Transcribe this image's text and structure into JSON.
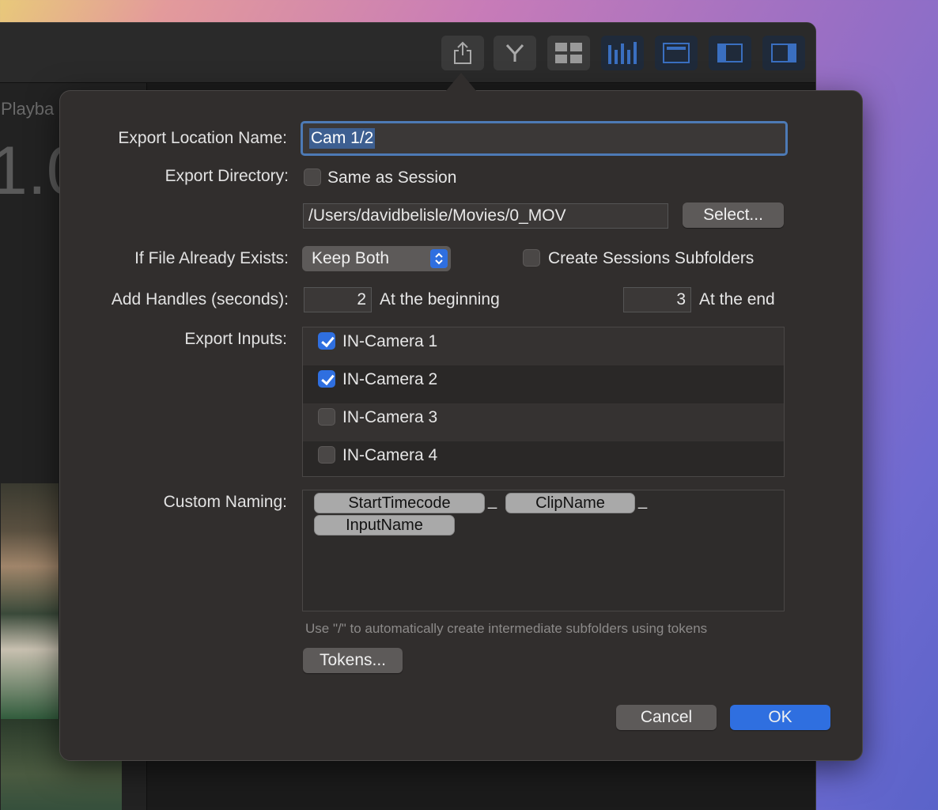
{
  "app": {
    "playback_label": "Playba",
    "speed_readout": "1.0"
  },
  "toolbar": {
    "buttons": [
      {
        "name": "share-icon"
      },
      {
        "name": "merge-icon"
      },
      {
        "name": "grid-icon"
      },
      {
        "name": "levels-icon"
      },
      {
        "name": "viewer-icon"
      },
      {
        "name": "left-sidebar-icon"
      },
      {
        "name": "right-sidebar-icon"
      }
    ]
  },
  "dialog": {
    "export_location_name_label": "Export Location Name:",
    "export_location_name_value": "Cam 1/2",
    "export_directory_label": "Export Directory:",
    "same_as_session_label": "Same as Session",
    "same_as_session_checked": false,
    "directory_path": "/Users/davidbelisle/Movies/0_MOV",
    "select_button": "Select...",
    "file_exists_label": "If File Already Exists:",
    "file_exists_value": "Keep Both",
    "create_subfolders_label": "Create Sessions Subfolders",
    "create_subfolders_checked": false,
    "handles_label": "Add Handles (seconds):",
    "handles_begin_value": "2",
    "handles_begin_label": "At the beginning",
    "handles_end_value": "3",
    "handles_end_label": "At the end",
    "export_inputs_label": "Export Inputs:",
    "inputs": [
      {
        "label": "IN-Camera 1",
        "checked": true
      },
      {
        "label": "IN-Camera 2",
        "checked": true
      },
      {
        "label": "IN-Camera 3",
        "checked": false
      },
      {
        "label": "IN-Camera 4",
        "checked": false
      }
    ],
    "custom_naming_label": "Custom Naming:",
    "tokens": [
      "StartTimecode",
      "ClipName",
      "InputName"
    ],
    "token_separator": "_",
    "hint": "Use \"/\" to automatically create intermediate subfolders using tokens",
    "tokens_button": "Tokens...",
    "cancel_button": "Cancel",
    "ok_button": "OK"
  },
  "colors": {
    "accent": "#2f6fe0",
    "dialog_bg": "#312e2d",
    "focus_ring": "#4d7ab5"
  }
}
